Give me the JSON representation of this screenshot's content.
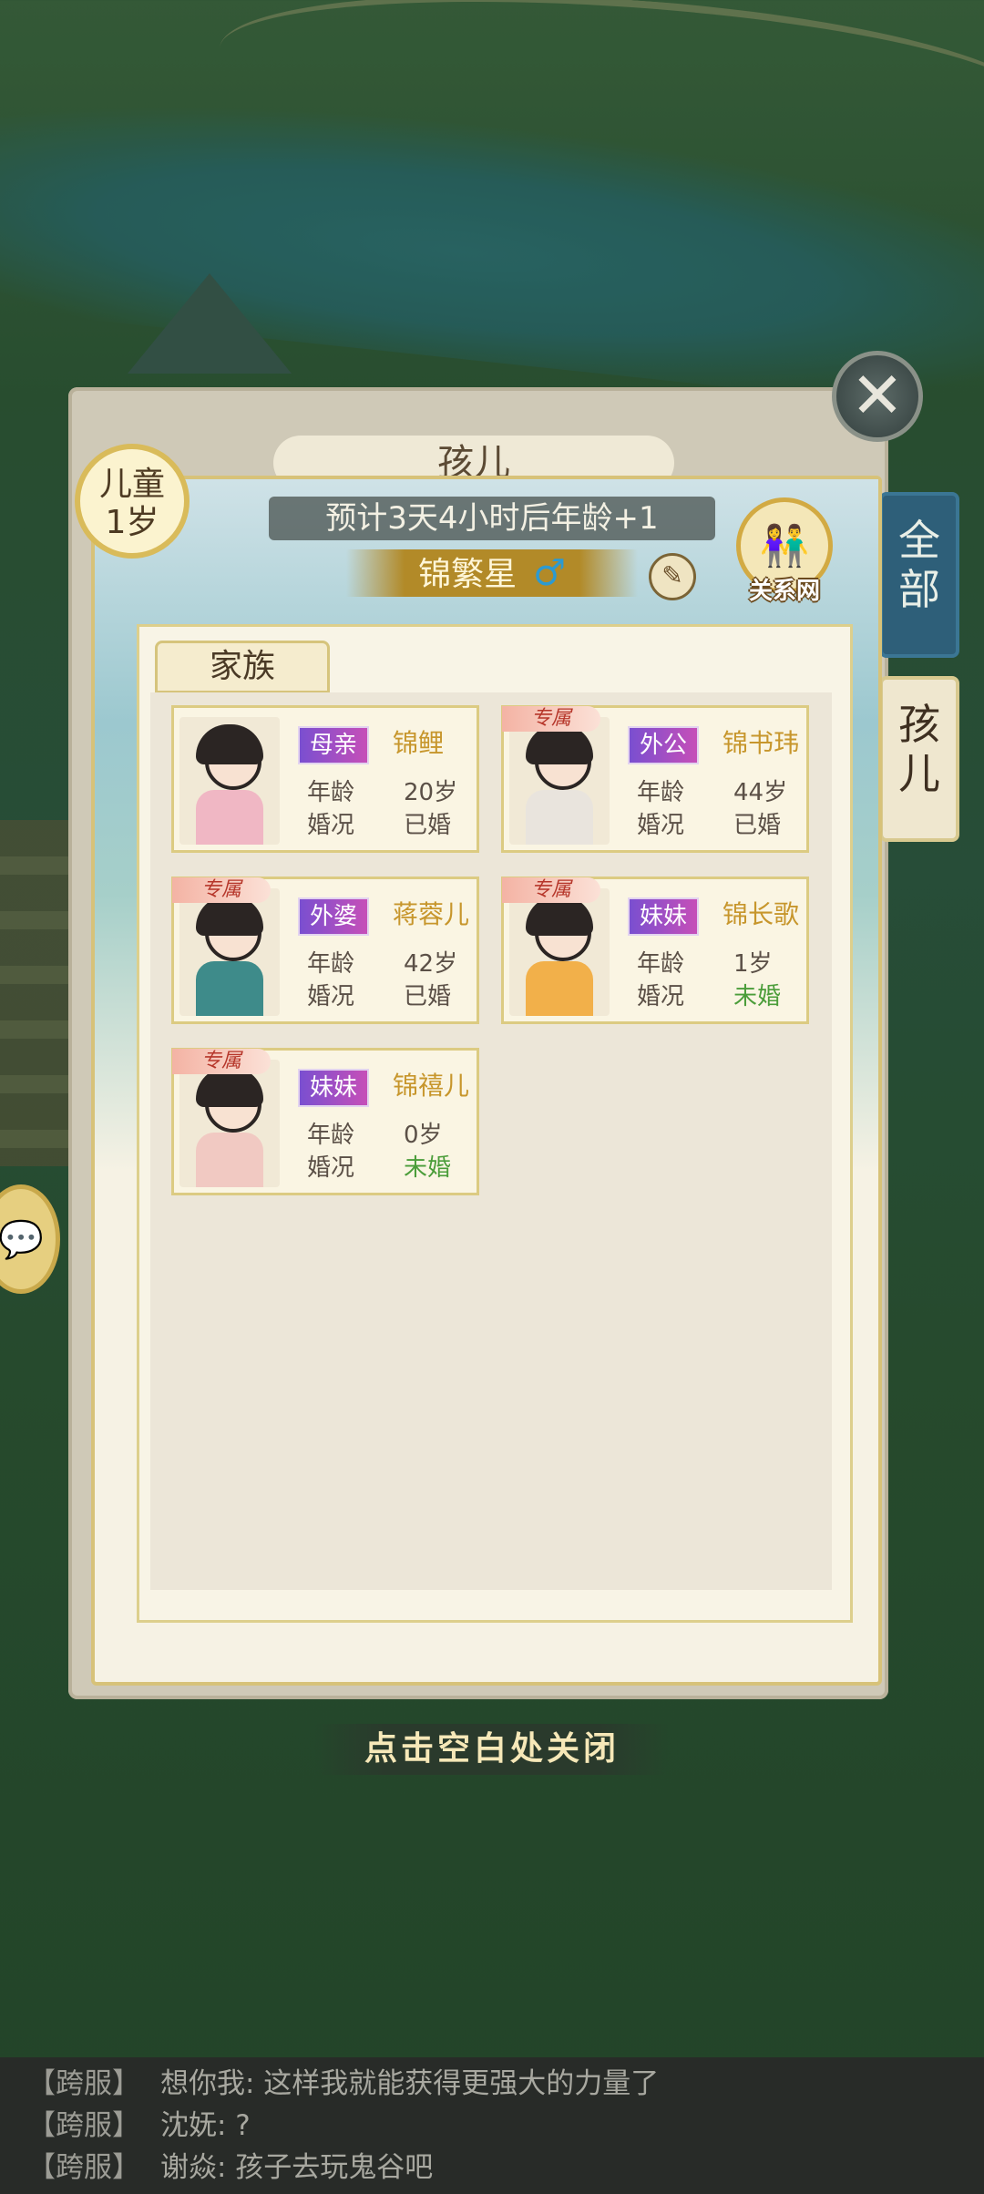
{
  "stage": {
    "label": "儿童",
    "age": "1岁"
  },
  "panel_title": "孩儿",
  "side_tabs": [
    {
      "label": "全部"
    },
    {
      "label": "孩儿"
    }
  ],
  "age_timer": "预计3天4小时后年龄+1",
  "character": {
    "name": "锦繁星",
    "gender_symbol": "♂"
  },
  "relations_button": "关系网",
  "family_tab": "家族",
  "field_labels": {
    "age": "年龄",
    "marital": "婚况"
  },
  "direct_tag": "专属",
  "members": [
    {
      "relation": "母亲",
      "name": "锦鲤",
      "age": "20岁",
      "marital": "已婚",
      "direct": false,
      "outfit": "#f0b7c4"
    },
    {
      "relation": "外公",
      "name": "锦书玮",
      "age": "44岁",
      "marital": "已婚",
      "direct": true,
      "outfit": "#e9e4dd"
    },
    {
      "relation": "外婆",
      "name": "蒋蓉儿",
      "age": "42岁",
      "marital": "已婚",
      "direct": true,
      "outfit": "#3e8b8a"
    },
    {
      "relation": "妹妹",
      "name": "锦长歌",
      "age": "1岁",
      "marital": "未婚",
      "direct": true,
      "outfit": "#f2b04a"
    },
    {
      "relation": "妹妹",
      "name": "锦禧儿",
      "age": "0岁",
      "marital": "未婚",
      "direct": true,
      "outfit": "#f1c9c2"
    }
  ],
  "close_hint": "点击空白处关闭",
  "chat": [
    {
      "server": "【跨服】",
      "text": "想你我: 这样我就能获得更强大的力量了"
    },
    {
      "server": "【跨服】",
      "text": "沈妩: ?"
    },
    {
      "server": "【跨服】",
      "text": "谢焱: 孩子去玩鬼谷吧"
    }
  ],
  "colors": {
    "accent_gold": "#c7962c",
    "unmarried_green": "#4b9d3a",
    "badge_purple": "#7a4fd0"
  },
  "icons": {
    "close": "close-icon",
    "brush": "brush-icon",
    "chat": "chat-bubble-icon"
  }
}
